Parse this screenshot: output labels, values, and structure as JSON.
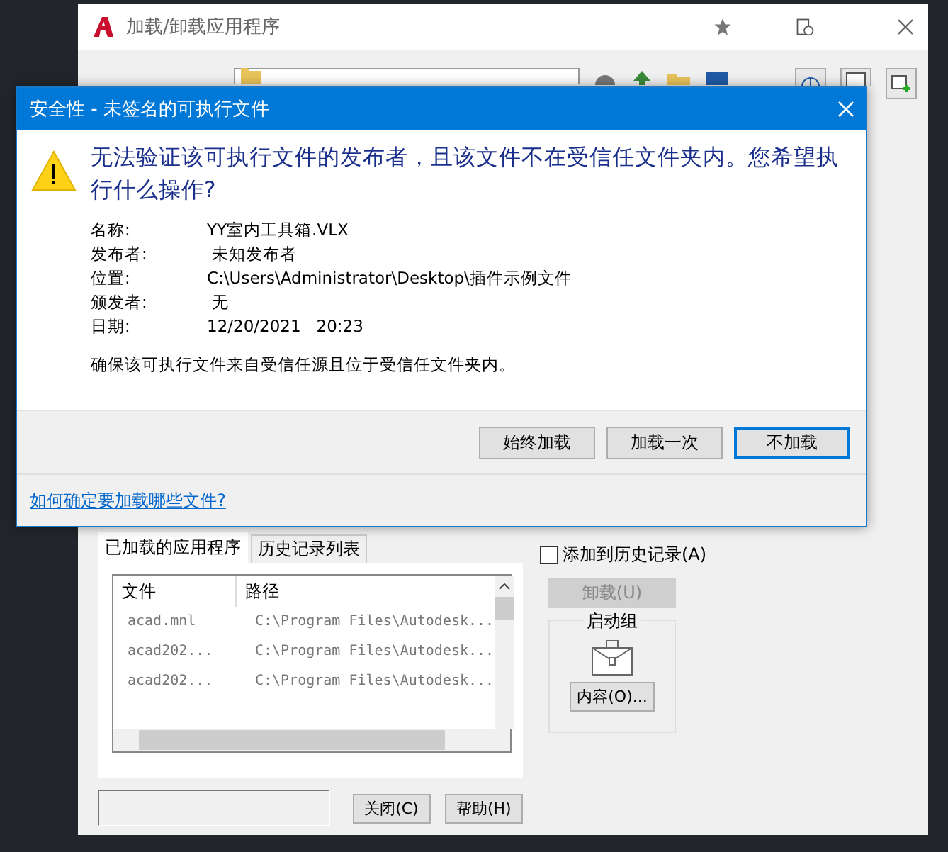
{
  "window": {
    "title": "加载/卸载应用程序"
  },
  "tabs": [
    {
      "label": "已加载的应用程序",
      "selected": true
    },
    {
      "label": "历史记录列表",
      "selected": false
    }
  ],
  "table": {
    "columns": [
      "文件",
      "路径"
    ],
    "rows": [
      {
        "file": "acad.mnl",
        "path": "C:\\Program Files\\Autodesk..."
      },
      {
        "file": "acad202...",
        "path": "C:\\Program Files\\Autodesk..."
      },
      {
        "file": "acad202...",
        "path": "C:\\Program Files\\Autodesk..."
      }
    ]
  },
  "history_checkbox": {
    "label": "添加到历史记录(A)",
    "checked": false
  },
  "unload_button": {
    "label": "卸载(U)",
    "disabled": true
  },
  "startup_group": {
    "title": "启动组",
    "button": "内容(O)..."
  },
  "bottom_buttons": [
    "关闭(C)",
    "帮助(H)"
  ],
  "dialog": {
    "title": "安全性 - 未签名的可执行文件",
    "heading": "无法验证该可执行文件的发布者，且该文件不在受信任文件夹内。您希望执行什么操作?",
    "details": [
      {
        "label": "名称:",
        "value": "YY室内工具箱.VLX"
      },
      {
        "label": "发布者:",
        "value": " 未知发布者"
      },
      {
        "label": "位置:",
        "value": "C:\\Users\\Administrator\\Desktop\\插件示例文件"
      },
      {
        "label": "颁发者:",
        "value": " 无"
      },
      {
        "label": "日期:",
        "value": "12/20/2021   20:23"
      }
    ],
    "note": "确保该可执行文件来自受信任源且位于受信任文件夹内。",
    "buttons": [
      {
        "label": "始终加载",
        "default": false
      },
      {
        "label": "加载一次",
        "default": false
      },
      {
        "label": "不加载",
        "default": true
      }
    ],
    "link": "如何确定要加载哪些文件?"
  }
}
